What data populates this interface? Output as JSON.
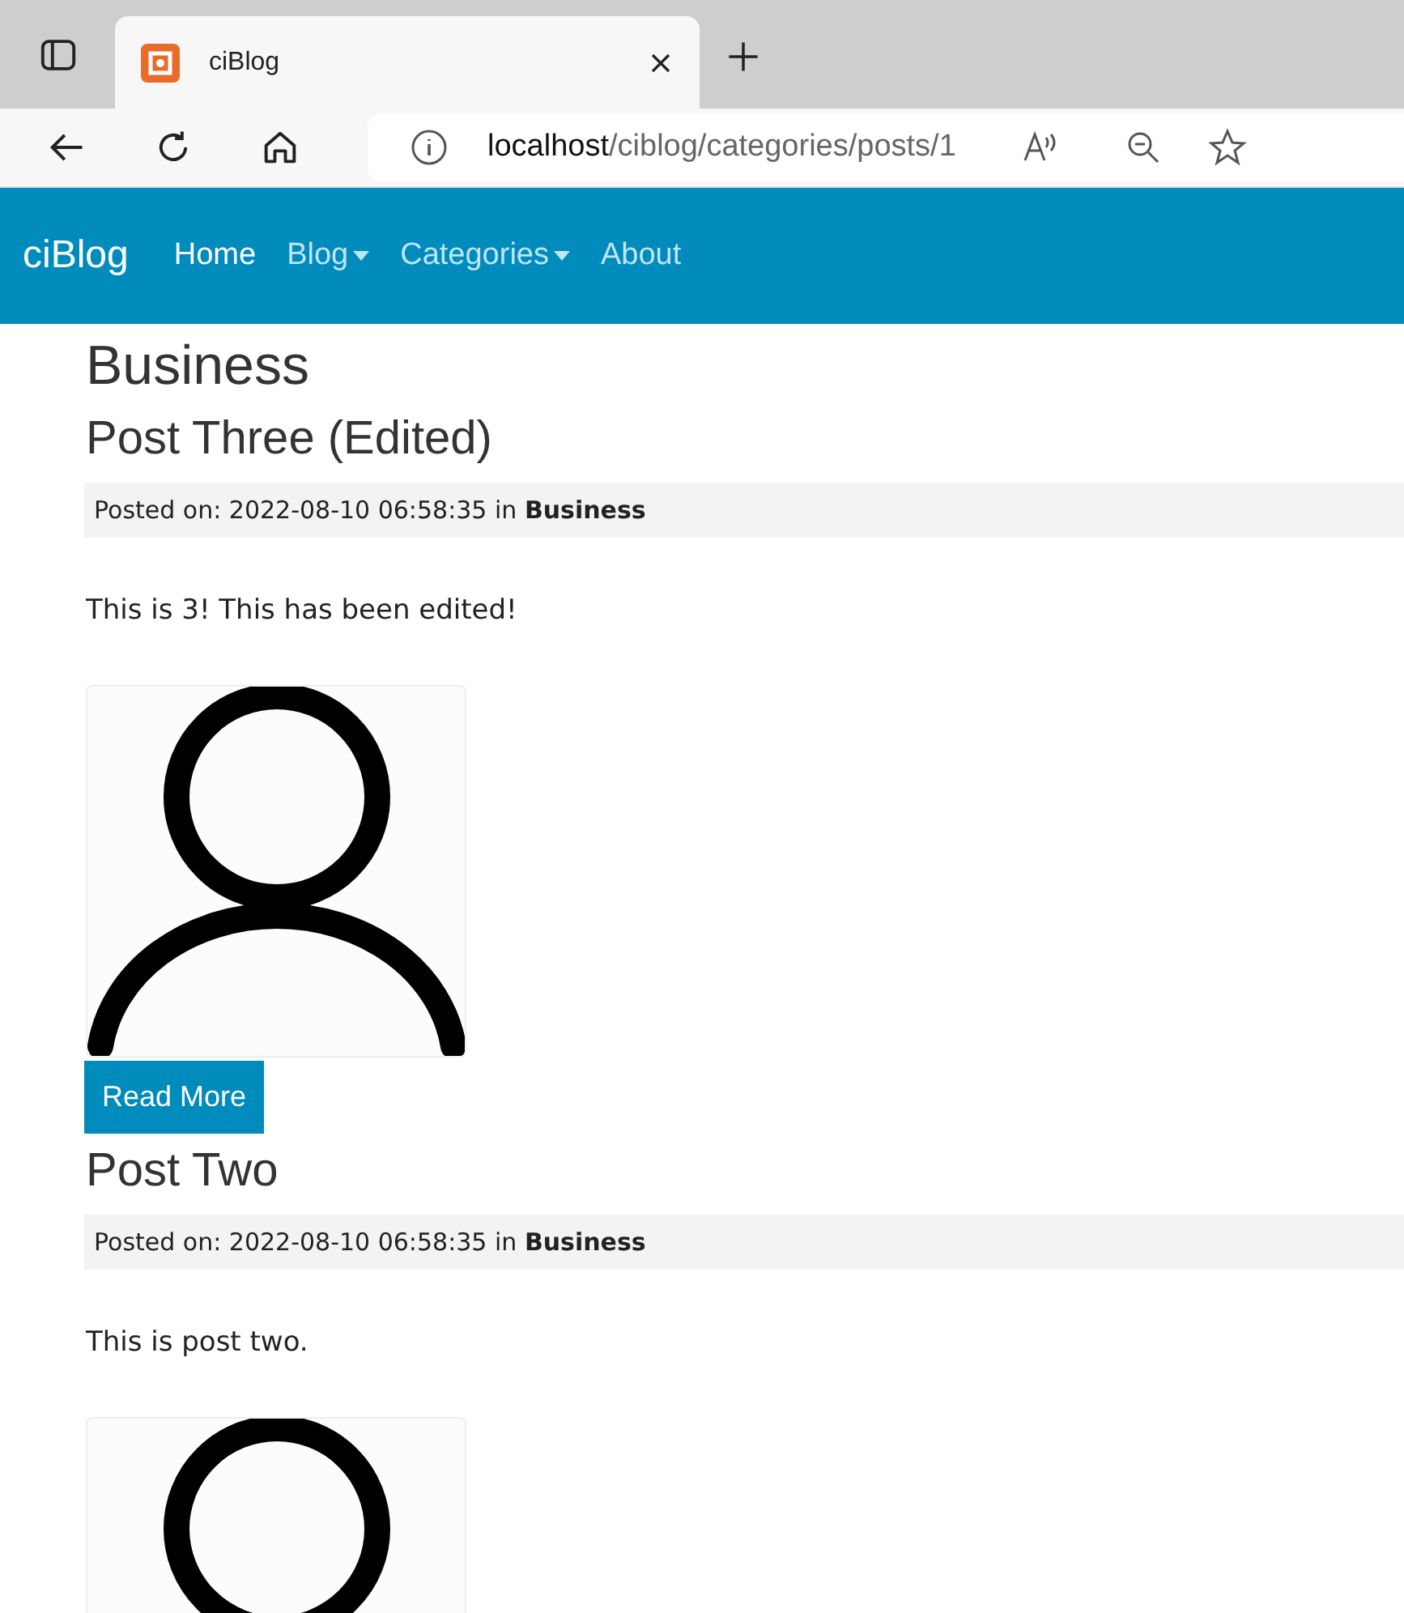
{
  "browser": {
    "tab_title": "ciBlog",
    "url_host": "localhost",
    "url_path": "/ciblog/categories/posts/1"
  },
  "navbar": {
    "brand": "ciBlog",
    "items": [
      {
        "label": "Home",
        "selected": true,
        "kind": "link"
      },
      {
        "label": "Blog",
        "selected": false,
        "kind": "dropdown"
      },
      {
        "label": "Categories",
        "selected": false,
        "kind": "dropdown"
      },
      {
        "label": "About",
        "selected": false,
        "kind": "link"
      }
    ]
  },
  "page_title": "Business",
  "posts": [
    {
      "title": "Post Three (Edited)",
      "meta": "Posted on: 2022-08-10 06:58:35 in **Business**",
      "body": "This is 3! This has been edited!",
      "button": "Read More"
    },
    {
      "title": "Post Two",
      "meta": "Posted on: 2022-08-10 06:58:35 in **Business**",
      "body": "This is post two."
    }
  ]
}
